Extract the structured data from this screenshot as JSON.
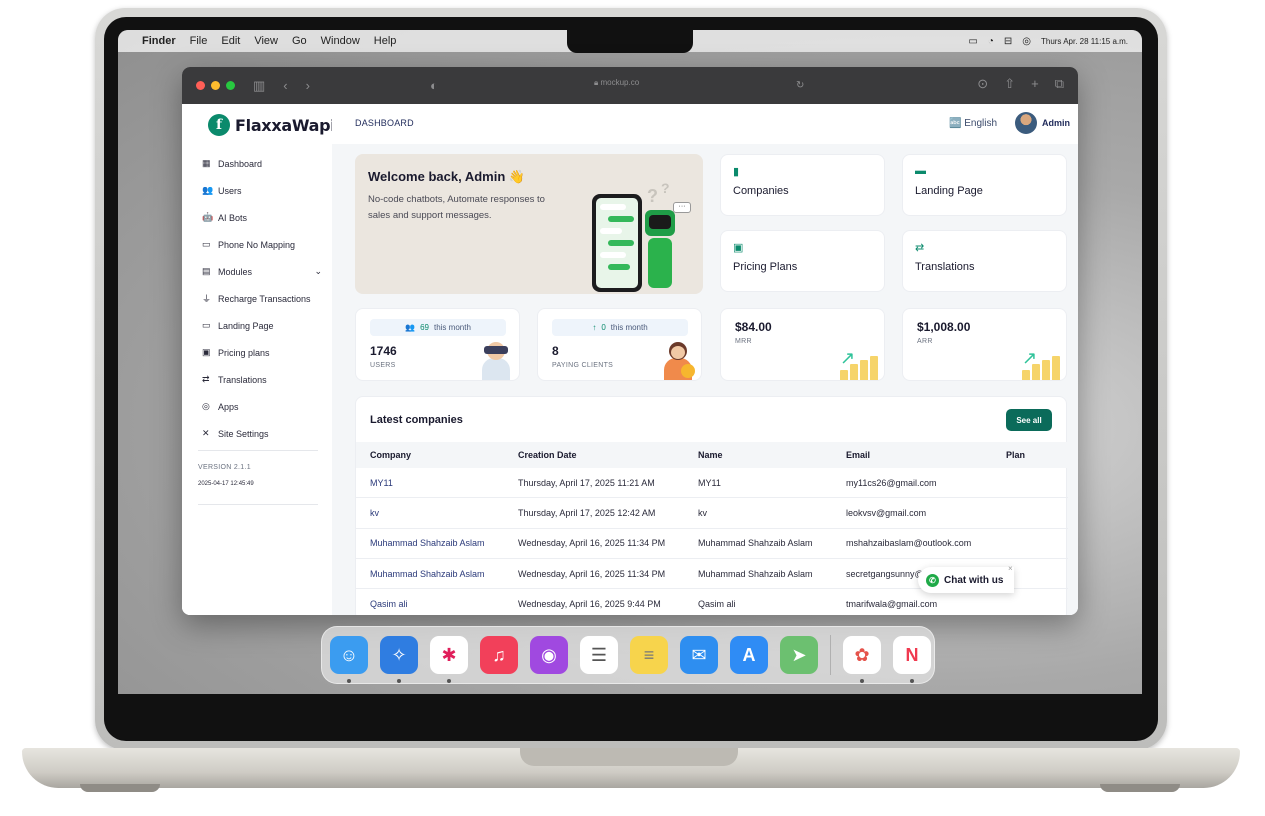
{
  "menubar": {
    "apple": "",
    "items": [
      "Finder",
      "File",
      "Edit",
      "View",
      "Go",
      "Window",
      "Help"
    ],
    "clock": "Thurs Apr. 28  11:15 a.m."
  },
  "browser": {
    "url": "mockup.co"
  },
  "app": {
    "logo_letter": "f",
    "logo_text": "FlaxxaWapi",
    "nav": [
      {
        "label": "Dashboard",
        "icon": "▦"
      },
      {
        "label": "Users",
        "icon": "👥"
      },
      {
        "label": "AI Bots",
        "icon": "🤖"
      },
      {
        "label": "Phone No Mapping",
        "icon": "▭"
      },
      {
        "label": "Modules",
        "icon": "▤",
        "chevron": "⌄"
      },
      {
        "label": "Recharge Transactions",
        "icon": "⏚"
      },
      {
        "label": "Landing Page",
        "icon": "▭"
      },
      {
        "label": "Pricing plans",
        "icon": "▣"
      },
      {
        "label": "Translations",
        "icon": "⇄"
      },
      {
        "label": "Apps",
        "icon": "◎"
      },
      {
        "label": "Site Settings",
        "icon": "✕"
      }
    ],
    "version": "VERSION 2.1.1",
    "version_date": "2025-04-17 12:45:49",
    "breadcrumb": "DASHBOARD",
    "language": "🔤 English",
    "admin": "Admin"
  },
  "welcome": {
    "title": "Welcome back, Admin 👋",
    "subtitle": "No-code chatbots, Automate responses to sales and support messages."
  },
  "quick_cards": [
    {
      "label": "Companies",
      "icon": "▮"
    },
    {
      "label": "Landing Page",
      "icon": "▬"
    },
    {
      "label": "Pricing Plans",
      "icon": "▣"
    },
    {
      "label": "Translations",
      "icon": "⇄"
    }
  ],
  "stats": {
    "users": {
      "pill_icon": "👥",
      "pill_count": "69",
      "pill_text": "this month",
      "value": "1746",
      "label": "USERS"
    },
    "paying": {
      "pill_icon": "↑",
      "pill_count": "0",
      "pill_text": "this month",
      "value": "8",
      "label": "PAYING CLIENTS"
    },
    "mrr": {
      "value": "$84.00",
      "label": "MRR"
    },
    "arr": {
      "value": "$1,008.00",
      "label": "ARR"
    }
  },
  "companies": {
    "title": "Latest companies",
    "see_all": "See all",
    "columns": [
      "Company",
      "Creation Date",
      "Name",
      "Email",
      "Plan"
    ],
    "rows": [
      {
        "company": "MY11",
        "date": "Thursday, April 17, 2025 11:21 AM",
        "name": "MY11",
        "email": "my11cs26@gmail.com",
        "plan": ""
      },
      {
        "company": "kv",
        "date": "Thursday, April 17, 2025 12:42 AM",
        "name": "kv",
        "email": "leokvsv@gmail.com",
        "plan": ""
      },
      {
        "company": "Muhammad Shahzaib Aslam",
        "date": "Wednesday, April 16, 2025 11:34 PM",
        "name": "Muhammad Shahzaib Aslam",
        "email": "mshahzaibaslam@outlook.com",
        "plan": ""
      },
      {
        "company": "Muhammad Shahzaib Aslam",
        "date": "Wednesday, April 16, 2025 11:34 PM",
        "name": "Muhammad Shahzaib Aslam",
        "email": "secretgangsunny@gmail.com",
        "plan": ""
      },
      {
        "company": "Qasim ali",
        "date": "Wednesday, April 16, 2025 9:44 PM",
        "name": "Qasim ali",
        "email": "tmarifwala@gmail.com",
        "plan": ""
      }
    ]
  },
  "chat_widget": {
    "label": "Chat with us",
    "close": "×"
  },
  "dock": [
    {
      "name": "finder",
      "color": "#3b9cf0",
      "glyph": "☺",
      "running": true
    },
    {
      "name": "safari",
      "color": "#2f7de1",
      "glyph": "✧",
      "running": true
    },
    {
      "name": "slack",
      "color": "#ffffff",
      "glyph": "✱",
      "running": true
    },
    {
      "name": "music",
      "color": "#f2405a",
      "glyph": "♫",
      "running": false
    },
    {
      "name": "podcasts",
      "color": "#a049e0",
      "glyph": "◉",
      "running": false
    },
    {
      "name": "reminders",
      "color": "#ffffff",
      "glyph": "☰",
      "running": false
    },
    {
      "name": "notes",
      "color": "#f7d44c",
      "glyph": "≡",
      "running": false
    },
    {
      "name": "mail",
      "color": "#2e8ef0",
      "glyph": "✉",
      "running": false
    },
    {
      "name": "app-store",
      "color": "#2f8cf5",
      "glyph": "A",
      "running": false
    },
    {
      "name": "maps",
      "color": "#6cc070",
      "glyph": "➤",
      "running": false
    },
    {
      "name": "photos",
      "color": "#ffffff",
      "glyph": "✿",
      "running": true
    },
    {
      "name": "news",
      "color": "#ffffff",
      "glyph": "N",
      "running": true
    }
  ]
}
